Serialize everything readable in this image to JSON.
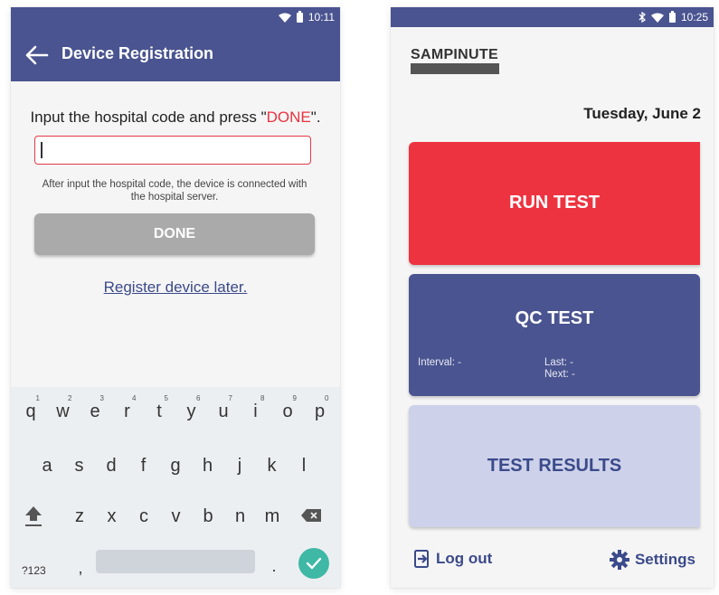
{
  "left": {
    "status_time": "10:11",
    "title": "Device Registration",
    "instruction_prefix": "Input the hospital code and press \"",
    "instruction_done": "DONE",
    "instruction_suffix": "\".",
    "input_value": "",
    "hint": "After input the hospital code, the device is connected with the hospital server.",
    "done_label": "DONE",
    "register_later": "Register device later.",
    "keyboard": {
      "row1": [
        [
          "q",
          "1"
        ],
        [
          "w",
          "2"
        ],
        [
          "e",
          "3"
        ],
        [
          "r",
          "4"
        ],
        [
          "t",
          "5"
        ],
        [
          "y",
          "6"
        ],
        [
          "u",
          "7"
        ],
        [
          "i",
          "8"
        ],
        [
          "o",
          "9"
        ],
        [
          "p",
          "0"
        ]
      ],
      "row2": [
        "a",
        "s",
        "d",
        "f",
        "g",
        "h",
        "j",
        "k",
        "l"
      ],
      "row3": [
        "z",
        "x",
        "c",
        "v",
        "b",
        "n",
        "m"
      ],
      "sym_label": "?123",
      "comma": ",",
      "period": "."
    }
  },
  "right": {
    "status_time": "10:25",
    "logo": "SAMPINUTE",
    "date": "Tuesday, June 2",
    "run_test": "RUN TEST",
    "qc_test": "QC TEST",
    "qc_interval": "Interval: -",
    "qc_last": "Last: -",
    "qc_next": "Next: -",
    "test_results": "TEST RESULTS",
    "logout": "Log out",
    "settings": "Settings"
  },
  "colors": {
    "primary": "#4a5490",
    "accent_red": "#ee3340",
    "light_tile": "#cdd2ea",
    "enter_key": "#3fb8a6"
  }
}
